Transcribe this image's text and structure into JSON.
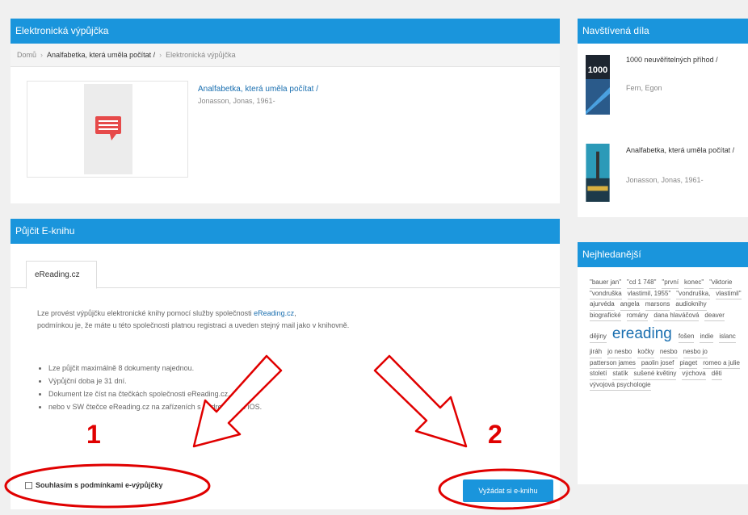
{
  "main_panel": {
    "title": "Elektronická výpůjčka",
    "breadcrumb": [
      "Domů",
      "Analfabetka, která uměla počítat /",
      "Elektronická výpůjčka"
    ]
  },
  "book": {
    "title": "Analfabetka, která uměla počítat /",
    "author": "Jonasson, Jonas, 1961-"
  },
  "borrow_panel": {
    "title": "Půjčit E-knihu",
    "tab_label": "eReading.cz",
    "desc_line1_prefix": "Lze provést výpůjčku elektronické knihy pomocí služby společnosti ",
    "desc_line1_link": "eReading.cz",
    "desc_line1_suffix": ",",
    "desc_line2": "podmínkou je, že máte u této společnosti platnou registraci a uveden stejný mail jako v knihovně.",
    "rules": [
      "Lze půjčit maximálně 8 dokumenty najednou.",
      "Výpůjční doba je 31 dní.",
      "Dokument lze číst na čtečkách společnosti eReading.cz,",
      "nebo v SW čtečce eReading.cz na zařízeních s Android nebo iOS."
    ],
    "agree_label": "Souhlasím s podmínkami e-výpůjčky",
    "submit_label": "Vyžádat si e-knihu"
  },
  "visited_panel": {
    "title": "Navštívená díla",
    "items": [
      {
        "title": "1000 neuvěřitelných příhod /",
        "author": "Fern, Egon",
        "cover_text": "1000"
      },
      {
        "title": "Analfabetka, která uměla počítat /",
        "author": "Jonasson, Jonas, 1961-"
      }
    ]
  },
  "popular_panel": {
    "title": "Nejhledanější",
    "tags": [
      "\"bauer jan\"",
      "\"cd 1 748\"",
      "\"první",
      "konec\"",
      "\"viktorie",
      "\"vondruška",
      "vlastimil, 1955\"",
      "\"vondruška,",
      "vlastimil\"",
      "ajurvéda",
      "angela",
      "marsons",
      "audioknihy",
      "biografické",
      "romány",
      "dana hlaváčová",
      "deaver",
      "dějiny",
      "ereading",
      "fošen",
      "indie",
      "islanc",
      "jiráh",
      "jo nesbo",
      "kočky",
      "nesbo",
      "nesbo jo",
      "patterson james",
      "paolin josef",
      "piaget",
      "romeo a julie",
      "století",
      "statík",
      "sušené květiny",
      "výchova",
      "děti",
      "vývojová psychologie"
    ],
    "big_tag": "ereading"
  },
  "annotations": {
    "step1": "1",
    "step2": "2"
  },
  "colors": {
    "accent": "#1a95dc",
    "annotation": "#e00000"
  }
}
